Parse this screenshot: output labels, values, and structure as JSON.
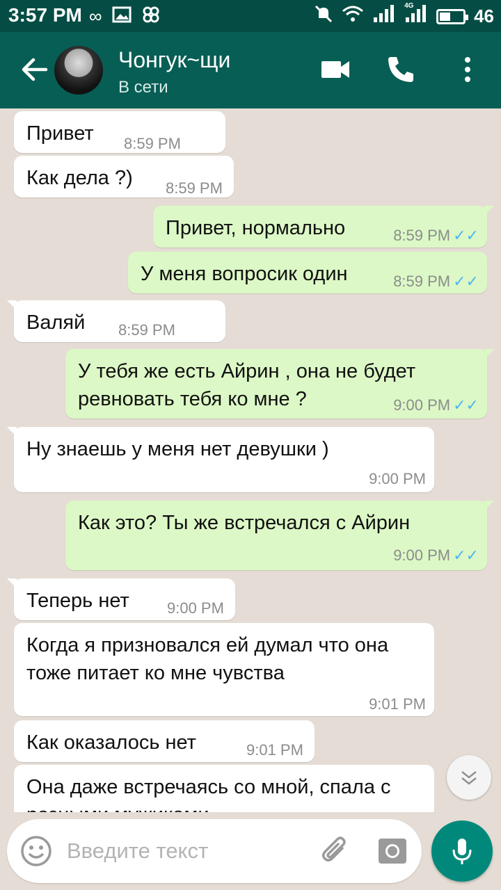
{
  "status_bar": {
    "time": "3:57 PM",
    "network_label": "4G",
    "battery_percent": "46",
    "battery_level": 0.46,
    "icons": [
      "infinity-icon",
      "gallery-icon",
      "pinwheel-icon",
      "mute-icon",
      "wifi-icon",
      "signal-icon",
      "signal-4g-icon",
      "battery-icon"
    ]
  },
  "header": {
    "contact_name": "Чонгук~щи",
    "status": "В сети",
    "icons": [
      "back-arrow-icon",
      "video-call-icon",
      "phone-icon",
      "more-vert-icon"
    ],
    "color": "#075e54"
  },
  "messages": [
    {
      "dir": "in",
      "text": "Привет",
      "time": "8:59 PM"
    },
    {
      "dir": "in",
      "text": "Как дела ?)",
      "time": "8:59 PM"
    },
    {
      "dir": "out",
      "text": "Привет, нормально",
      "time": "8:59 PM"
    },
    {
      "dir": "out",
      "text": "У меня вопросик один",
      "time": "8:59 PM"
    },
    {
      "dir": "in",
      "text": "Валяй",
      "time": "8:59 PM"
    },
    {
      "dir": "out",
      "text": "У тебя же есть Айрин , она не будет ревновать тебя ко мне ?",
      "time": "9:00 PM"
    },
    {
      "dir": "in",
      "text": "Ну знаешь у меня нет девушки )",
      "time": "9:00 PM"
    },
    {
      "dir": "out",
      "text": "Как это? Ты же встречался с Айрин",
      "time": "9:00 PM"
    },
    {
      "dir": "in",
      "text": "Теперь нет",
      "time": "9:00 PM"
    },
    {
      "dir": "in",
      "text": "Когда я признoвался ей думал что она тоже питает ко мне чувства",
      "time": "9:01 PM"
    },
    {
      "dir": "in",
      "text": "Как оказалось нет",
      "time": "9:01 PM"
    },
    {
      "dir": "in",
      "text": "Она даже встречаясь со мной, спала с разными мужиками",
      "time": ""
    }
  ],
  "read_receipt_color": "#4fb5f0",
  "input": {
    "placeholder": "Введите текст",
    "icons": [
      "emoji-icon",
      "attach-icon",
      "camera-icon",
      "mic-icon",
      "scroll-down-icon"
    ]
  },
  "colors": {
    "outgoing": "#dcf8c6",
    "incoming": "#ffffff",
    "background": "#e5ddd5",
    "fab": "#00897b"
  }
}
